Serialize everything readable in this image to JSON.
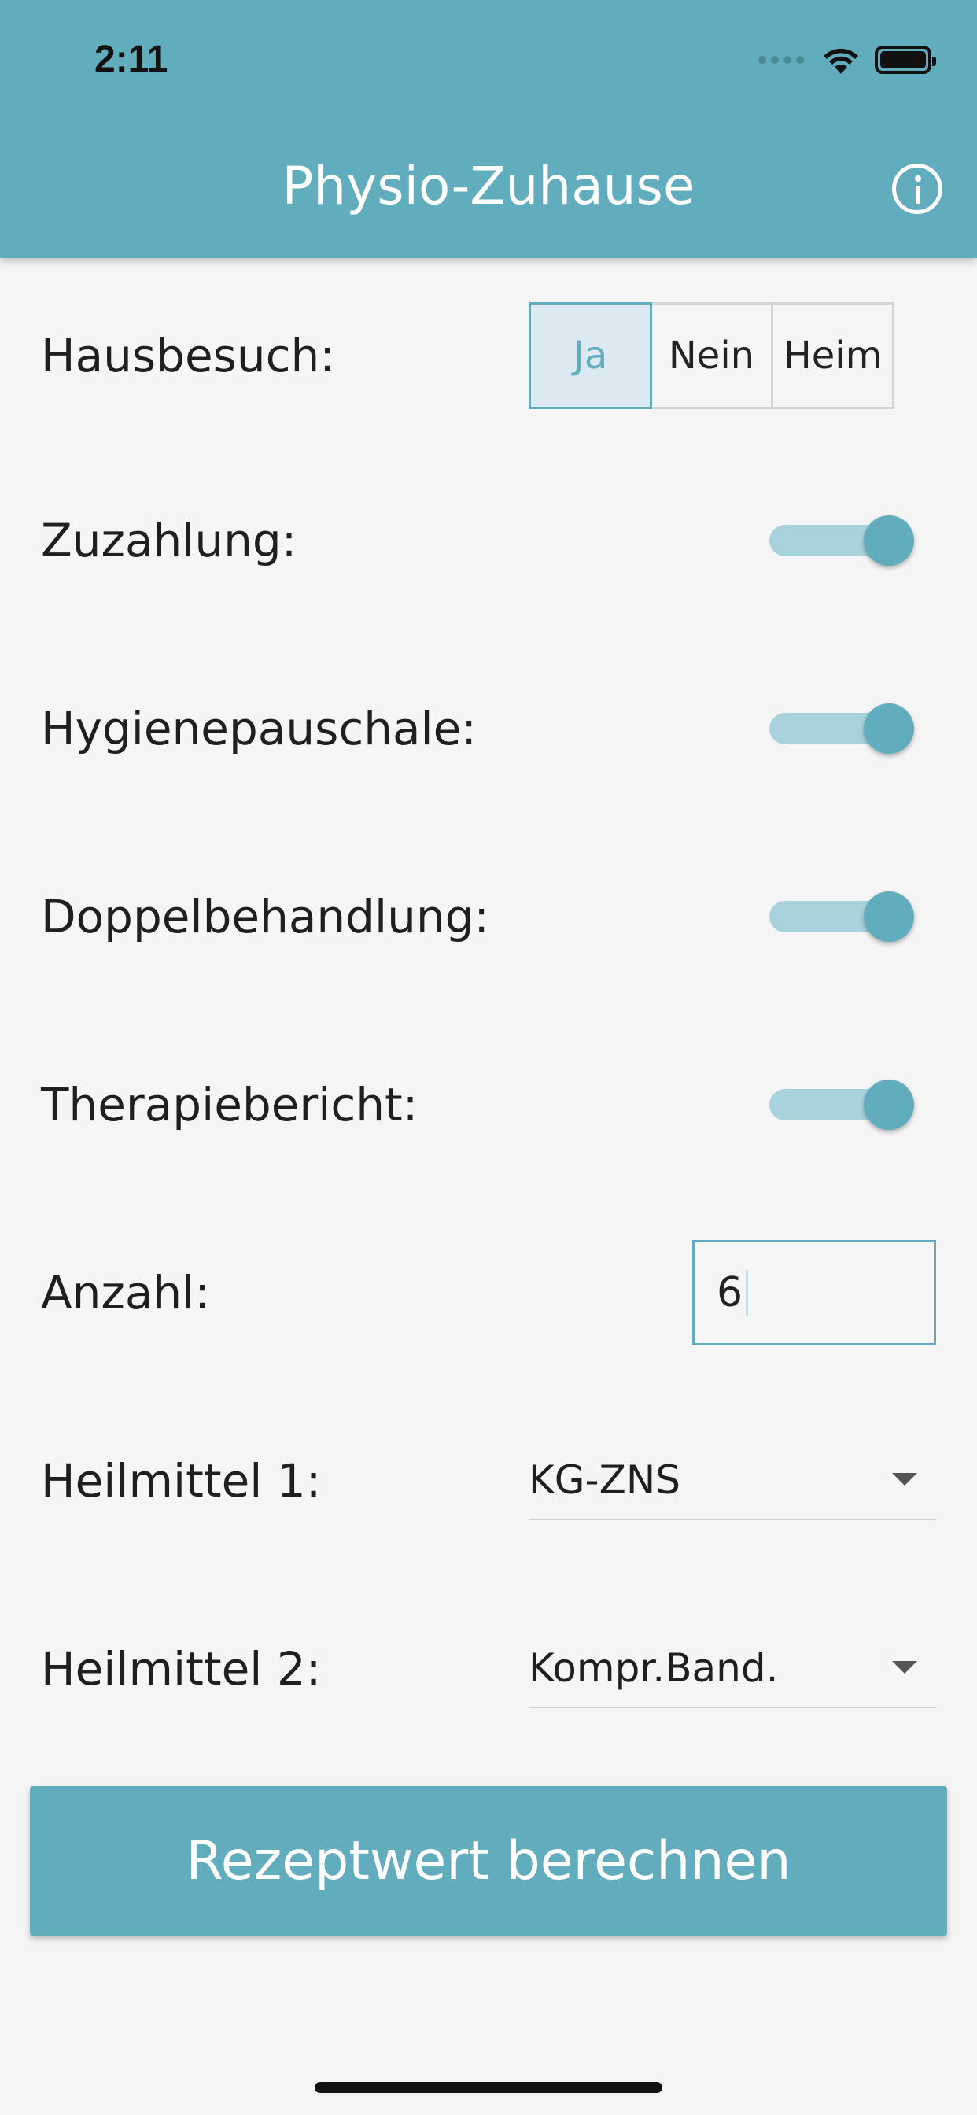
{
  "status_bar": {
    "time": "2:11"
  },
  "header": {
    "title": "Physio-Zuhause"
  },
  "form": {
    "hausbesuch": {
      "label": "Hausbesuch:",
      "options": [
        "Ja",
        "Nein",
        "Heim"
      ],
      "selected": "Ja"
    },
    "zuzahlung": {
      "label": "Zuzahlung:",
      "on": true
    },
    "hygienepauschale": {
      "label": "Hygienepauschale:",
      "on": true
    },
    "doppelbehandlung": {
      "label": "Doppelbehandlung:",
      "on": true
    },
    "therapiebericht": {
      "label": "Therapiebericht:",
      "on": true
    },
    "anzahl": {
      "label": "Anzahl:",
      "value": "6"
    },
    "heilmittel1": {
      "label": "Heilmittel 1:",
      "value": "KG-ZNS"
    },
    "heilmittel2": {
      "label": "Heilmittel 2:",
      "value": "Kompr.Band."
    }
  },
  "actions": {
    "calculate_label": "Rezeptwert berechnen"
  },
  "colors": {
    "primary": "#62adbd",
    "toggle_track": "#a9d3dc",
    "selected_segment_bg": "#dce9f2",
    "background": "#f5f5f5"
  },
  "icons": {
    "info": "info-icon",
    "wifi": "wifi-icon",
    "battery": "battery-icon",
    "dropdown": "chevron-down-icon"
  }
}
